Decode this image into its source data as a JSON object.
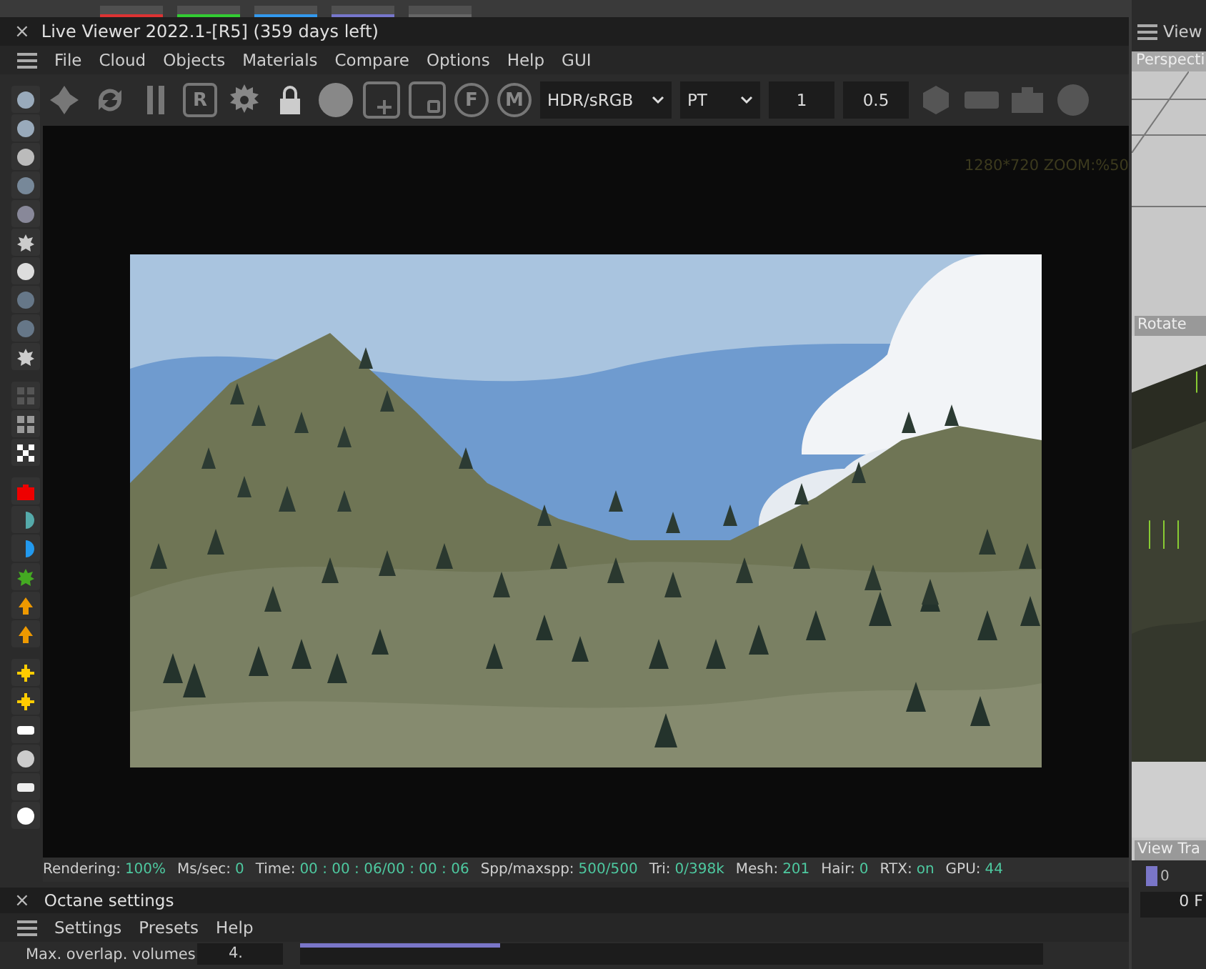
{
  "window": {
    "title": "Live Viewer 2022.1-[R5] (359 days left)",
    "close": "×"
  },
  "menu": [
    "File",
    "Cloud",
    "Objects",
    "Materials",
    "Compare",
    "Options",
    "Help",
    "GUI"
  ],
  "toolbar": {
    "letters": [
      "R",
      "F",
      "M"
    ],
    "selects": [
      {
        "value": "HDR/sRGB"
      },
      {
        "value": "PT"
      }
    ],
    "fields": [
      {
        "value": "1"
      },
      {
        "value": "0.5"
      }
    ]
  },
  "viewport": {
    "info": "1280*720 ZOOM:%50"
  },
  "status": [
    {
      "label": "Rendering:",
      "value": "100%"
    },
    {
      "label": "Ms/sec:",
      "value": "0"
    },
    {
      "label": "Time:",
      "value": "00 : 00 : 06/00 : 00 : 06"
    },
    {
      "label": "Spp/maxspp:",
      "value": "500/500"
    },
    {
      "label": "Tri:",
      "value": "0/398k"
    },
    {
      "label": "Mesh:",
      "value": "201"
    },
    {
      "label": "Hair:",
      "value": "0"
    },
    {
      "label": "RTX:",
      "value": "on"
    },
    {
      "label": "GPU:",
      "value": "44"
    }
  ],
  "octane": {
    "title": "Octane settings",
    "close": "×",
    "menu": [
      "Settings",
      "Presets",
      "Help"
    ],
    "row": {
      "label": "Max. overlap. volumes",
      "value": "4.",
      "level": 0.27
    }
  },
  "side": {
    "title": "View",
    "camera": "Perspecti",
    "rotate": "Rotate",
    "view": "View Tra",
    "frame": "0",
    "frame_field": "0 F"
  }
}
